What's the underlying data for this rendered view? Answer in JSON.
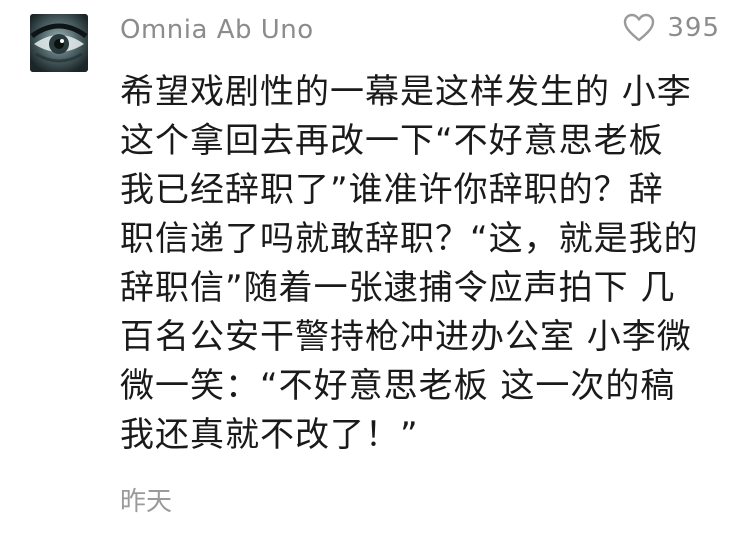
{
  "comment": {
    "username": "Omnia Ab Uno",
    "likes": "395",
    "icons": {
      "like": "heart-outline-icon"
    },
    "colors": {
      "meta_text": "#8c8c8c",
      "body_text": "#1a1a1a"
    },
    "lines": [
      "希望戏剧性的一幕是这样发生的 小李",
      "这个拿回去再改一下“不好意思老板",
      "我已经辞职了”谁准许你辞职的？辞",
      "职信递了吗就敢辞职？“这，就是我的",
      "辞职信”随着一张逮捕令应声拍下 几",
      "百名公安干警持枪冲进办公室 小李微",
      "微一笑：“不好意思老板 这一次的稿",
      "我还真就不改了！”"
    ],
    "timestamp": "昨天"
  }
}
